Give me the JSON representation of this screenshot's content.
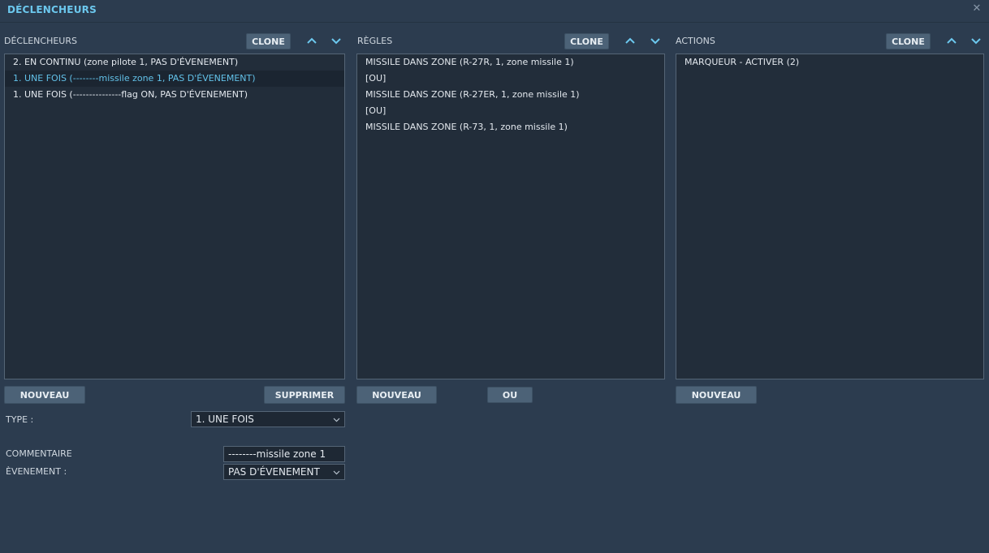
{
  "window": {
    "title": "DÉCLENCHEURS",
    "close_glyph": "✕"
  },
  "triggers": {
    "label": "DÉCLENCHEURS",
    "clone_label": "CLONE",
    "items": [
      "2. EN CONTINU (zone pilote 1, PAS D'ÉVENEMENT)",
      "1. UNE FOIS (--------missile zone 1, PAS D'ÉVENEMENT)",
      "1. UNE FOIS (---------------flag ON, PAS D'ÉVENEMENT)"
    ],
    "selected_index": 1,
    "new_label": "NOUVEAU",
    "delete_label": "SUPPRIMER"
  },
  "rules": {
    "label": "RÈGLES",
    "clone_label": "CLONE",
    "items": [
      "MISSILE DANS ZONE (R-27R, 1, zone missile 1)",
      "[OU]",
      "MISSILE DANS ZONE (R-27ER, 1, zone missile 1)",
      "[OU]",
      "MISSILE DANS ZONE (R-73, 1, zone missile 1)"
    ],
    "new_label": "NOUVEAU",
    "or_label": "OU"
  },
  "actions": {
    "label": "ACTIONS",
    "clone_label": "CLONE",
    "items": [
      "MARQUEUR - ACTIVER (2)"
    ],
    "new_label": "NOUVEAU"
  },
  "form": {
    "type_label": "TYPE :",
    "type_value": "1. UNE FOIS",
    "comment_label": "COMMENTAIRE",
    "comment_value": "--------missile zone 1",
    "event_label": "ÈVENEMENT :",
    "event_value": "PAS D'ÉVENEMENT"
  },
  "icons": {
    "up": "chevron-up-icon",
    "down": "chevron-down-icon",
    "dropdown": "chevron-down-icon",
    "close": "close-icon"
  },
  "colors": {
    "background": "#2c3c4f",
    "title": "#6cc8ee",
    "selected_text": "#62c1e8",
    "list_bg": "#222d3a",
    "button_bg": "#4c6277"
  }
}
